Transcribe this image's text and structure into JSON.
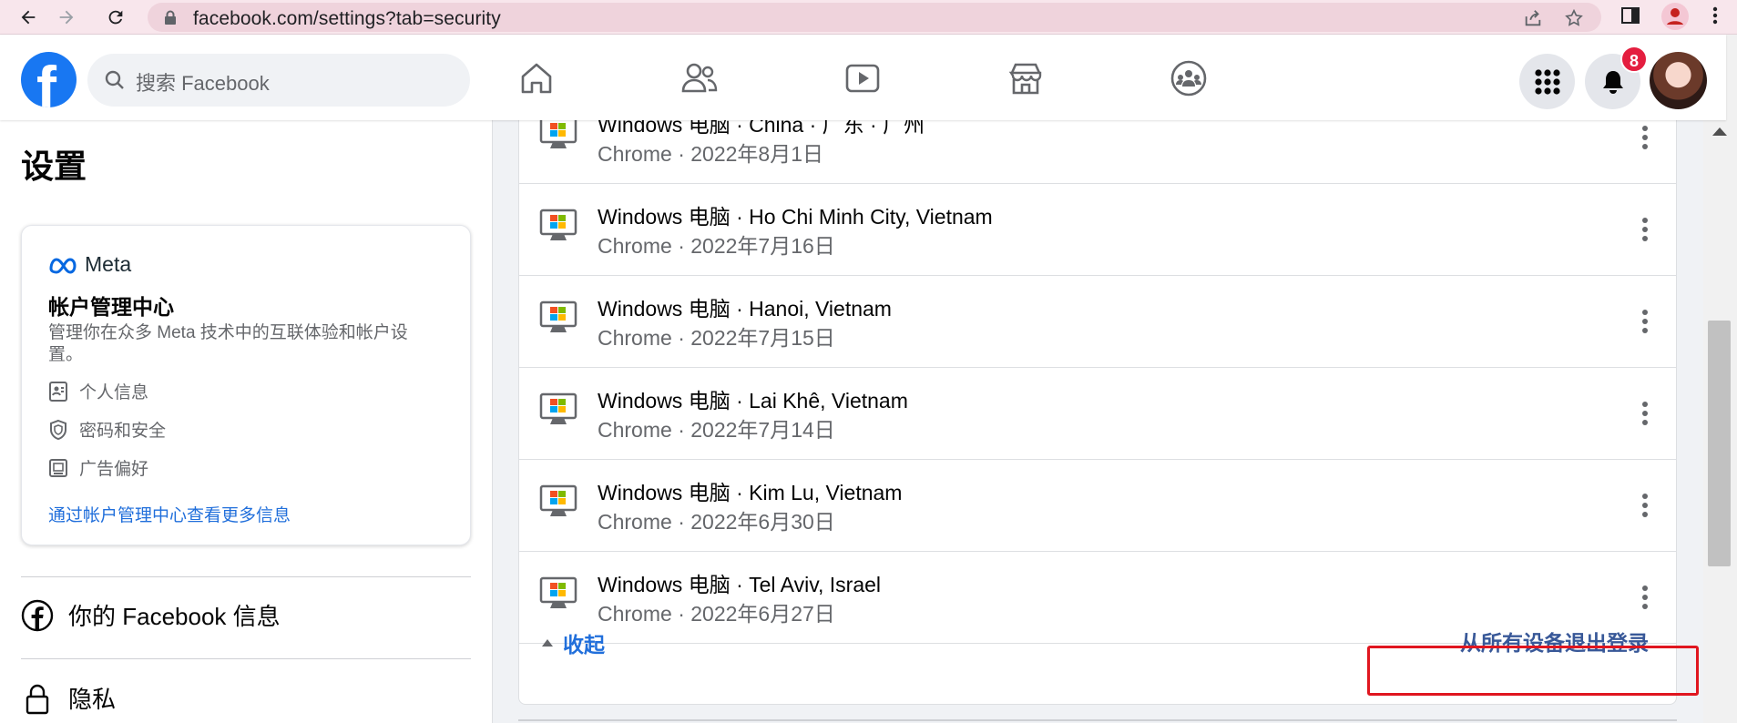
{
  "browser": {
    "url": "facebook.com/settings?tab=security",
    "icons": [
      "back-icon",
      "forward-icon",
      "reload-icon",
      "lock-icon",
      "share-icon",
      "star-icon",
      "sidebar-icon",
      "profile-icon",
      "more-icon"
    ]
  },
  "header": {
    "logo": "f",
    "search_placeholder": "搜索 Facebook",
    "notification_count": "8",
    "nav_icons": [
      "home-icon",
      "friends-icon",
      "watch-icon",
      "marketplace-icon",
      "groups-icon"
    ]
  },
  "sidebar": {
    "title": "设置",
    "accounts_center": {
      "brand": "Meta",
      "title": "帐户管理中心",
      "description": "管理你在众多 Meta 技术中的互联体验和帐户设置。",
      "items": [
        {
          "label": "个人信息",
          "icon": "id-card-icon"
        },
        {
          "label": "密码和安全",
          "icon": "shield-icon"
        },
        {
          "label": "广告偏好",
          "icon": "monitor-icon"
        }
      ],
      "link": "通过帐户管理中心查看更多信息"
    },
    "menu": [
      {
        "label": "你的 Facebook 信息",
        "icon": "facebook-icon"
      },
      {
        "label": "隐私",
        "icon": "lock-icon"
      }
    ]
  },
  "sessions": {
    "rows": [
      {
        "device": "Windows 电脑 · China · 广东 · 广州",
        "detail": "Chrome · 2022年8月1日"
      },
      {
        "device": "Windows 电脑 · Ho Chi Minh City, Vietnam",
        "detail": "Chrome · 2022年7月16日"
      },
      {
        "device": "Windows 电脑 · Hanoi, Vietnam",
        "detail": "Chrome · 2022年7月15日"
      },
      {
        "device": "Windows 电脑 · Lai Khê, Vietnam",
        "detail": "Chrome · 2022年7月14日"
      },
      {
        "device": "Windows 电脑 · Kim Lu, Vietnam",
        "detail": "Chrome · 2022年6月30日"
      },
      {
        "device": "Windows 电脑 · Tel Aviv, Israel",
        "detail": "Chrome · 2022年6月27日"
      }
    ],
    "collapse_label": "收起",
    "logout_all_label": "从所有设备退出登录"
  },
  "colors": {
    "brand_blue": "#1877f2",
    "link_blue": "#216fdb",
    "highlight_red": "#e0161f",
    "notification_red": "#e41e3f"
  }
}
